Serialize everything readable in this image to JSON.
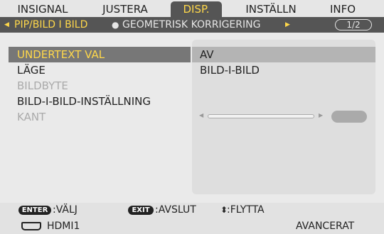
{
  "tabs": [
    {
      "label": "INSIGNAL",
      "active": false
    },
    {
      "label": "JUSTERA",
      "active": false
    },
    {
      "label": "DISP.",
      "active": true
    },
    {
      "label": "INSTÄLLN",
      "active": false
    },
    {
      "label": "INFO",
      "active": false
    }
  ],
  "subnav": {
    "left_arrow_icon": "triangle-left-icon",
    "right_arrow_icon": "triangle-right-icon",
    "items": [
      "PIP/BILD I BILD",
      "GEOMETRISK KORRIGERING"
    ],
    "separator": "●",
    "page": "1/2"
  },
  "menu": [
    {
      "label": "UNDERTEXT VAL",
      "state": "selected",
      "value": "AV"
    },
    {
      "label": "LÄGE",
      "state": "normal",
      "value": "BILD-I-BILD"
    },
    {
      "label": "BILDBYTE",
      "state": "disabled",
      "value": ""
    },
    {
      "label": "BILD-I-BILD-INSTÄLLNING",
      "state": "normal",
      "value": ""
    },
    {
      "label": "KANT",
      "state": "disabled",
      "value": ""
    }
  ],
  "kant_slider": {
    "icon": "slider-icon"
  },
  "footer": {
    "enter_key": "ENTER",
    "enter_action": ":VÄLJ",
    "exit_key": "EXIT",
    "exit_action": ":AVSLUT",
    "move_icon": "up-down-arrows-icon",
    "move_action": ":FLYTTA",
    "source_icon": "hdmi-port-icon",
    "source": "HDMI1",
    "level": "AVANCERAT"
  },
  "colors": {
    "highlight_text": "#ffd84a",
    "bar_dark": "#555555",
    "background": "#eaeaea"
  }
}
